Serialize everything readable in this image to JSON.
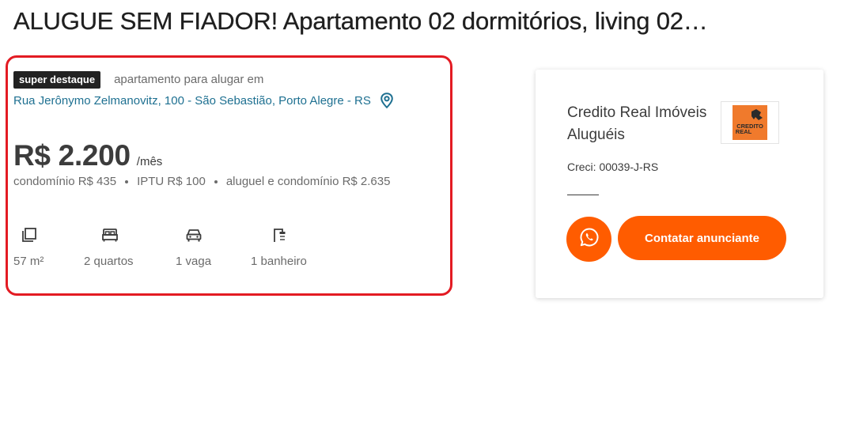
{
  "title": "ALUGUE SEM FIADOR! Apartamento 02 dormitórios, living 02…",
  "listing": {
    "badge": "super destaque",
    "type_label": "apartamento para alugar em",
    "address": "Rua Jerônymo Zelmanovitz, 100 - São Sebastião, Porto Alegre - RS",
    "price": "R$ 2.200",
    "price_unit": "/mês",
    "costs": [
      "condomínio R$ 435",
      "IPTU R$ 100",
      "aluguel e condomínio R$ 2.635"
    ],
    "features": [
      {
        "icon": "area-icon",
        "label": "57 m²"
      },
      {
        "icon": "bed-icon",
        "label": "2 quartos"
      },
      {
        "icon": "car-icon",
        "label": "1 vaga"
      },
      {
        "icon": "shower-icon",
        "label": "1 banheiro"
      }
    ]
  },
  "advertiser": {
    "name": "Credito Real Imóveis Aluguéis",
    "logo_text_top": "CREDITO",
    "logo_text_bottom": "REAL",
    "creci": "Creci: 00039-J-RS",
    "whatsapp_icon": "whatsapp-icon",
    "contact_label": "Contatar anunciante"
  },
  "colors": {
    "accent": "#ff5c00",
    "highlight_border": "#e31b23",
    "address_link": "#1e7091",
    "badge_bg": "#222222",
    "logo_bg": "#f07a2c"
  }
}
